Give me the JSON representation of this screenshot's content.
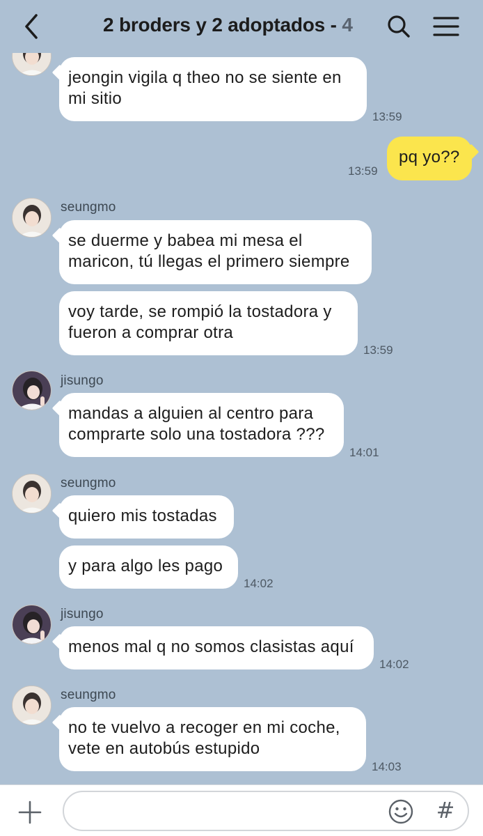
{
  "header": {
    "title": "2 broders y 2 adoptados -",
    "member_count": "4",
    "back_icon": "chevron-left-icon",
    "search_icon": "search-icon",
    "menu_icon": "hamburger-menu-icon"
  },
  "messages": [
    {
      "sender": "seungmo",
      "lines": [
        "jeongin vigila q theo no se siente en",
        "mi sitio"
      ],
      "time": "13:59"
    },
    {
      "sender": "me",
      "lines": [
        "pq yo??"
      ],
      "time": "13:59"
    },
    {
      "sender": "seungmo",
      "lines": [
        "se duerme y babea mi mesa el",
        "maricon, tú llegas el primero siempre"
      ]
    },
    {
      "sender": "seungmo",
      "lines": [
        "voy tarde, se rompió la tostadora y",
        "fueron a comprar otra"
      ],
      "time": "13:59"
    },
    {
      "sender": "jisungo",
      "lines": [
        "mandas a alguien al centro para",
        "comprarte solo una tostadora ???"
      ],
      "time": "14:01"
    },
    {
      "sender": "seungmo",
      "lines": [
        "quiero mis tostadas"
      ]
    },
    {
      "sender": "seungmo",
      "lines": [
        "y para algo les pago"
      ],
      "time": "14:02"
    },
    {
      "sender": "jisungo",
      "lines": [
        "menos mal q no somos clasistas aquí"
      ],
      "time": "14:02"
    },
    {
      "sender": "seungmo",
      "lines": [
        "no te vuelvo a recoger en mi coche,",
        "vete en autobús estupido"
      ],
      "time": "14:03"
    }
  ],
  "senders": {
    "seungmo": "seungmo",
    "jisungo": "jisungo"
  },
  "footer": {
    "input_placeholder": "",
    "plus_icon": "plus-icon",
    "emoji_icon": "smiley-icon",
    "hashtag_icon": "hashtag-icon",
    "hashtag_glyph": "#"
  },
  "colors": {
    "background": "#adc0d3",
    "own_bubble": "#fbe54d",
    "other_bubble": "#ffffff"
  }
}
